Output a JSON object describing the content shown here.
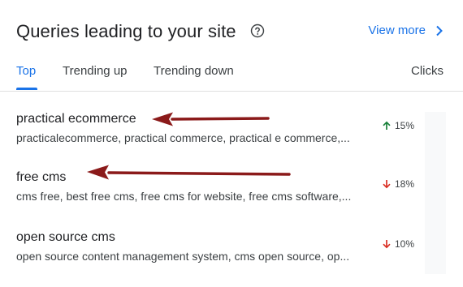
{
  "header": {
    "title": "Queries leading to your site",
    "view_more_label": "View more"
  },
  "tabs": [
    {
      "label": "Top",
      "active": true
    },
    {
      "label": "Trending up",
      "active": false
    },
    {
      "label": "Trending down",
      "active": false
    }
  ],
  "column_header": "Clicks",
  "rows": [
    {
      "query": "practical ecommerce",
      "related": "practicalecommerce, practical commerce, practical e commerce,...",
      "direction": "up",
      "change": "15%"
    },
    {
      "query": "free cms",
      "related": "cms free, best free cms, free cms for website, free cms software,...",
      "direction": "down",
      "change": "18%"
    },
    {
      "query": "open source cms",
      "related": "open source content management system, cms open source, op...",
      "direction": "down",
      "change": "10%"
    }
  ],
  "colors": {
    "accent": "#1a73e8",
    "up": "#188038",
    "down": "#d93025",
    "annotation_arrow": "#8b1a1a"
  },
  "icons": {
    "help": "help-circle-icon",
    "view_more": "chevron-right-icon",
    "trend_up": "arrow-up-icon",
    "trend_down": "arrow-down-icon"
  }
}
